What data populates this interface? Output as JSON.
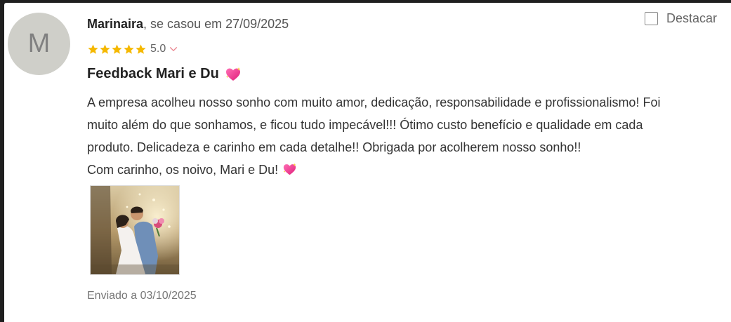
{
  "review": {
    "avatar_initial": "M",
    "author_name": "Marinaira",
    "married_text": ", se casou em 27/09/2025",
    "rating": "5.0",
    "star_count": 5,
    "star_color": "#f5b800",
    "chevron_color": "#e9848f",
    "feature_label": "Destacar",
    "title": "Feedback Mari e Du",
    "body_lines": [
      "A empresa acolheu nosso sonho com muito amor, dedicação, responsabilidade e profissionalismo! Foi",
      "muito além do que sonhamos, e ficou tudo impecável!!! Ótimo custo benefício e qualidade em cada",
      "produto. Delicadeza e carinho em cada detalhe!! Obrigada por acolherem nosso sonho!!",
      "Com carinho, os noivo, Mari e Du!"
    ],
    "heart_icon": "sparkling-heart-icon",
    "sent_date": "Enviado a 03/10/2025"
  }
}
